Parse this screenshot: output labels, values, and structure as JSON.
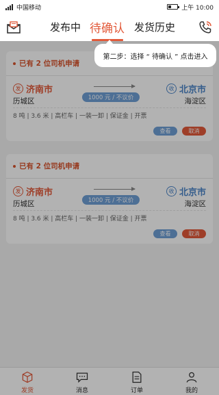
{
  "status_bar": {
    "carrier": "中国移动",
    "time": "上午 10:00",
    "battery_level": 0.3
  },
  "header": {
    "tabs": [
      {
        "label": "发布中",
        "active": false
      },
      {
        "label": "待确认",
        "active": true
      },
      {
        "label": "发货历史",
        "active": false
      }
    ],
    "left_icon": "mail-icon",
    "right_icon": "phone-icon"
  },
  "orders": [
    {
      "head": "已有 2 位司机申请",
      "from": {
        "icon_char": "发",
        "city": "济南市",
        "district": "历城区"
      },
      "to": {
        "icon_char": "收",
        "city": "北京市",
        "district": "海淀区"
      },
      "price": "1000 元 / 不议价",
      "details": "8 吨 | 3.6 米 | 高栏车 | 一装一卸 | 保证金 | 开票",
      "view_label": "查看",
      "cancel_label": "取消"
    },
    {
      "head": "已有 2 位司机申请",
      "from": {
        "icon_char": "发",
        "city": "济南市",
        "district": "历城区"
      },
      "to": {
        "icon_char": "收",
        "city": "北京市",
        "district": "海淀区"
      },
      "price": "1000 元 / 不议价",
      "details": "8 吨 | 3.6 米 | 高栏车 | 一装一卸 | 保证金 | 开票",
      "view_label": "查看",
      "cancel_label": "取消"
    }
  ],
  "tabbar": [
    {
      "label": "发货",
      "icon": "box-icon",
      "active": true
    },
    {
      "label": "消息",
      "icon": "message-icon",
      "active": false
    },
    {
      "label": "订单",
      "icon": "order-icon",
      "active": false
    },
    {
      "label": "我的",
      "icon": "user-icon",
      "active": false
    }
  ],
  "tooltip": {
    "text": "第二步：选择 “ 待确认 ” 点击进入"
  },
  "colors": {
    "accent": "#e25a3a",
    "blue": "#6f9fd6"
  }
}
